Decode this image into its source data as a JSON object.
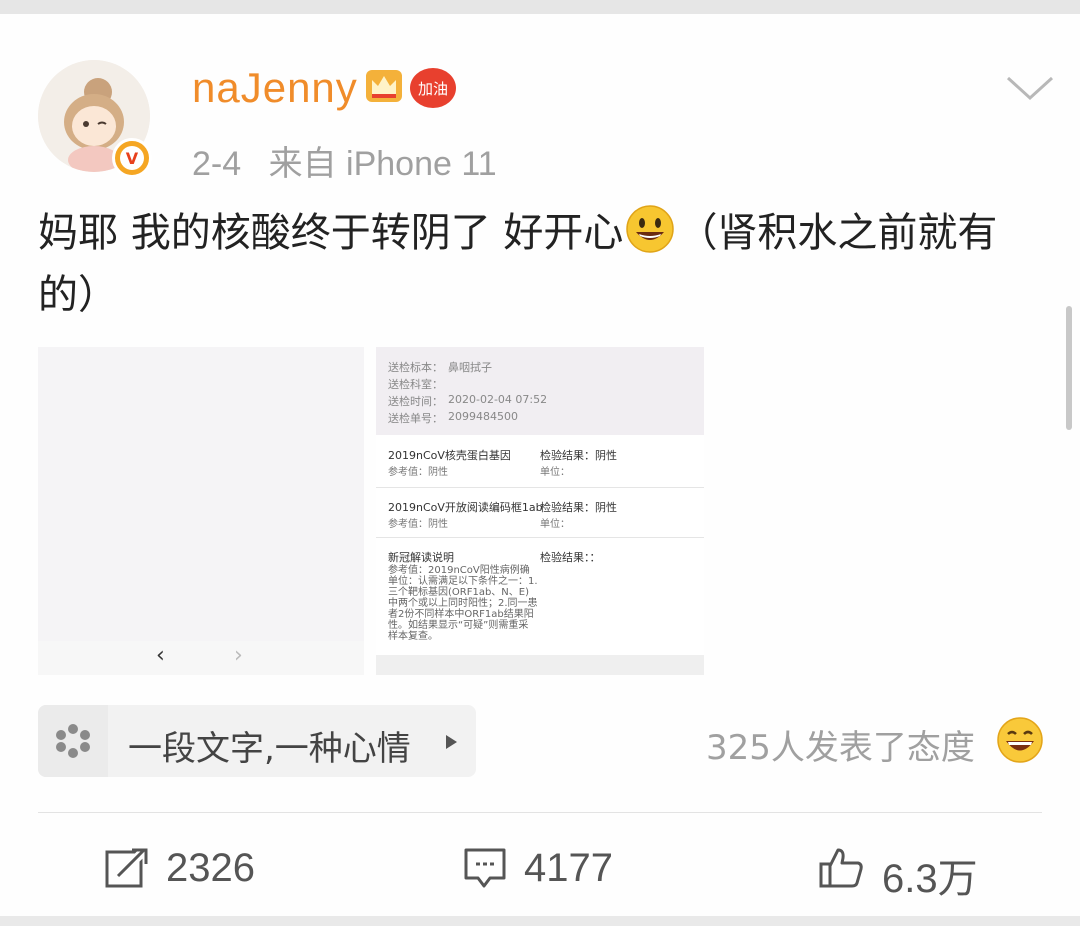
{
  "post": {
    "username": "naJenny",
    "badge_text": "加油",
    "verified_mark": "V",
    "timestamp": "2-4",
    "source": "来自 iPhone 11",
    "text_part1": "妈耶 我的核酸终于转阴了 好开心",
    "text_part2": "（肾积水之前就有的）"
  },
  "report": {
    "sample_label": "送检标本：",
    "sample_value": "鼻咽拭子",
    "dept_label": "送检科室：",
    "time_label": "送检时间：",
    "time_value": "2020-02-04 07:52",
    "order_label": "送检单号：",
    "order_value": "2099484500",
    "test1_name": "2019nCoV核壳蛋白基因",
    "test1_ref": "参考值：阴性",
    "test1_result": "检验结果：阴性",
    "test1_unit": "单位：",
    "test2_name": "2019nCoV开放阅读编码框1ab",
    "test2_ref": "参考值：阴性",
    "test2_result": "检验结果：阴性",
    "test2_unit": "单位：",
    "test3_name": "新冠解读说明",
    "test3_result": "检验结果：：",
    "test3_note": "参考值：2019nCoV阳性病例确 单位：认需满足以下条件之一：1.三个靶标基因(ORF1ab、N、E)中两个或以上同时阳性；2.同一患者2份不同样本中ORF1ab结果阳性。如结果显示“可疑”则需重采样本复查。"
  },
  "gallery": {
    "prev": "‹",
    "next": "›"
  },
  "mood": {
    "label": "一段文字,一种心情"
  },
  "attitude": {
    "text": "325人发表了态度"
  },
  "actions": {
    "repost_count": "2326",
    "comment_count": "4177",
    "like_count": "6.3万"
  },
  "colors": {
    "username": "#f08c2a",
    "badge": "#e8402e",
    "verified": "#f5a623"
  },
  "icons": [
    "chevron-down-icon",
    "crown-icon",
    "smiley-icon",
    "mood-icon",
    "repost-icon",
    "comment-icon",
    "like-icon"
  ]
}
